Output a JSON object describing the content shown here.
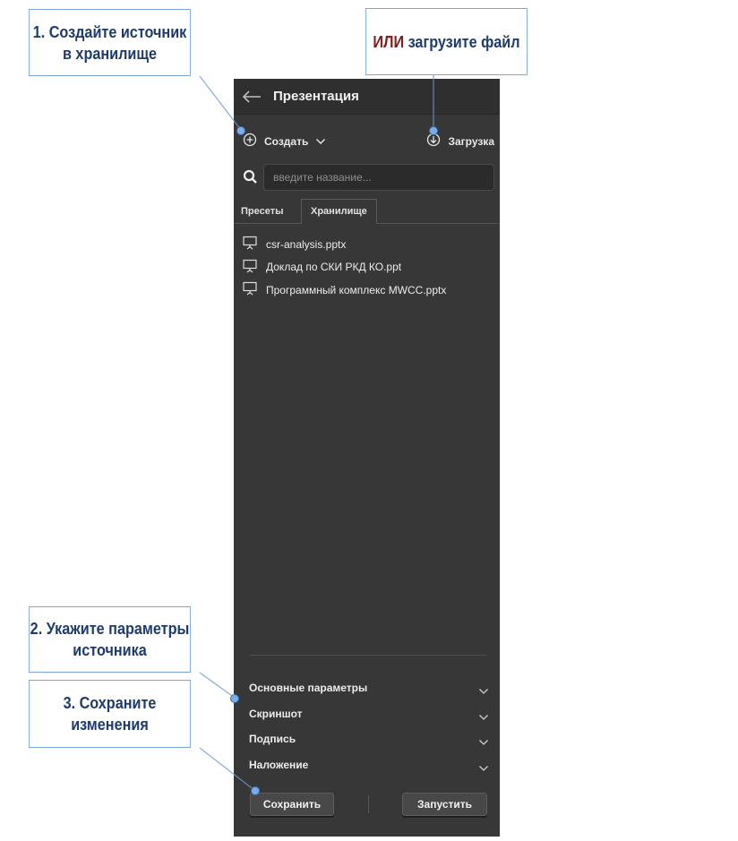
{
  "callouts": {
    "step1_line1": "1. Создайте источник",
    "step1_line2": "в хранилище",
    "or_prefix": "ИЛИ",
    "or_text": " загрузите файл",
    "step2_line1": "2. Укажите параметры",
    "step2_line2": "источника",
    "step3_line1": "3. Сохраните",
    "step3_line2": "изменения"
  },
  "header": {
    "title": "Презентация",
    "back_icon": "arrow-left-icon"
  },
  "toolbar": {
    "create_label": "Создать",
    "create_icon": "plus-circle-icon",
    "upload_label": "Загрузка",
    "upload_icon": "download-circle-icon"
  },
  "search": {
    "placeholder": "введите название..."
  },
  "tabs": {
    "presets": "Пресеты",
    "storage": "Хранилище",
    "active": "storage"
  },
  "files": [
    {
      "name": "csr-analysis.pptx"
    },
    {
      "name": "Доклад по СКИ РКД КО.ppt"
    },
    {
      "name": "Программный комплекс MWCC.pptx"
    }
  ],
  "sections": [
    {
      "label": "Основные параметры"
    },
    {
      "label": "Скриншот"
    },
    {
      "label": "Подпись"
    },
    {
      "label": "Наложение"
    }
  ],
  "actions": {
    "save_label": "Сохранить",
    "run_label": "Запустить"
  },
  "colors": {
    "panel_bg": "#373737",
    "callout_text": "#1f3b6e",
    "callout_accent": "#7b1f1f",
    "marker": "#7aaee8"
  }
}
